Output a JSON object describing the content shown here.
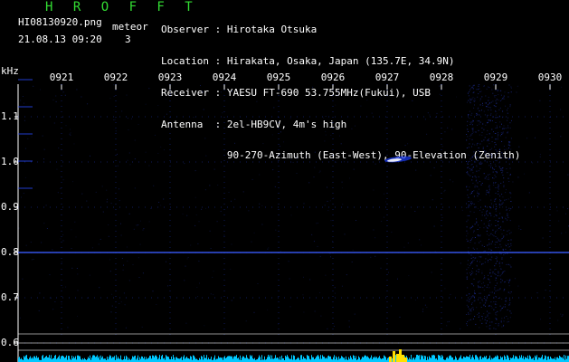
{
  "header": {
    "brand": "H R O F F T",
    "filename": "HI08130920.png",
    "datetime": "21.08.13 09:20",
    "meteor_label": "meteor",
    "meteor_count": "3"
  },
  "info": {
    "observer": "Observer : Hirotaka Otsuka",
    "location": "Location : Hirakata, Osaka, Japan (135.7E, 34.9N)",
    "receiver": "Receiver : YAESU FT-690 53.755MHz(Fukui), USB",
    "antenna": "Antenna  : 2el-HB9CV, 4m's high",
    "antenna2": "           90-270-Azimuth (East-West), 90-Elevation (Zenith)"
  },
  "axis": {
    "y_unit": "kHz",
    "y_ticks": [
      {
        "label": "1.1",
        "value": 1.1
      },
      {
        "label": "1.0",
        "value": 1.0
      },
      {
        "label": "0.9",
        "value": 0.9
      },
      {
        "label": "0.8",
        "value": 0.8
      },
      {
        "label": "0.7",
        "value": 0.7
      },
      {
        "label": "0.6",
        "value": 0.6
      }
    ],
    "x_ticks": [
      "0921",
      "0922",
      "0923",
      "0924",
      "0925",
      "0926",
      "0927",
      "0928",
      "0929",
      "0930"
    ]
  },
  "colors": {
    "brand": "#33dd33",
    "grid_dot": "#2a4aff",
    "carrier": "#3a5cff",
    "echo": "#ffffff",
    "spectrum_cyan": "#00c8ff",
    "spectrum_yellow": "#ffe000"
  }
}
